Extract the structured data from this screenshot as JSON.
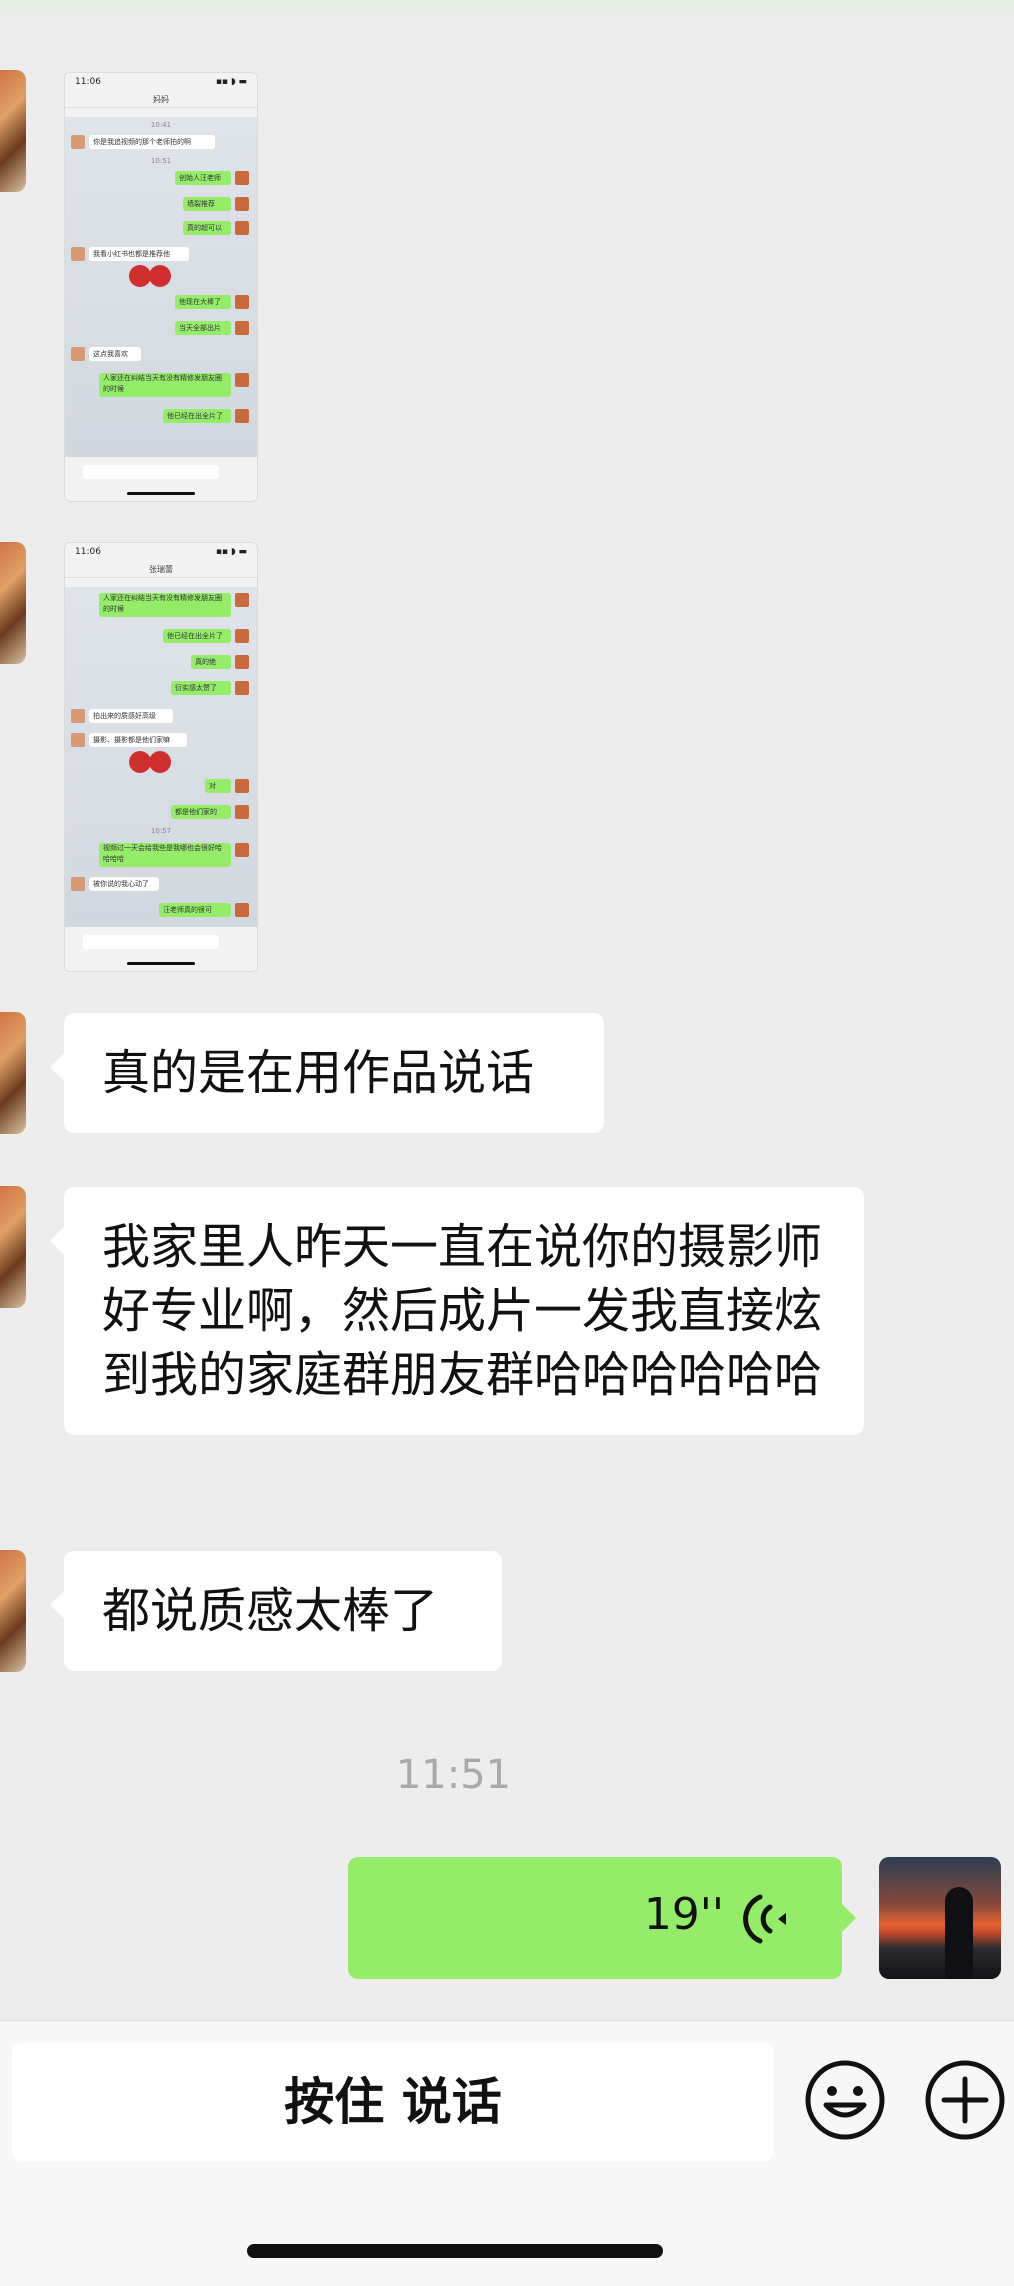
{
  "screenshot_1": {
    "status_time": "11:06",
    "nav_title": "妈妈",
    "time_a": "10:41",
    "time_b": "10:51",
    "msgs": [
      "你是我追视频的那个老师拍的啊",
      "创始人汪老师",
      "墙裂推荐",
      "真的超可以",
      "我看小红书也都是推荐他",
      "他现在大棒了",
      "当天全部出片",
      "这点我喜欢",
      "人家还在纠结当天有没有精修发朋友圈的时候",
      "他已经在出全片了"
    ]
  },
  "screenshot_2": {
    "status_time": "11:06",
    "nav_title": "张瑞蕾",
    "time_c": "10:57",
    "msgs": [
      "人家还在纠结当天有没有精修发朋友圈的时候",
      "他已经在出全片了",
      "真的绝",
      "衍实感太赞了",
      "拍出来的质感好高级",
      "摄影、摄影都是他们家嘛",
      "对",
      "都是他们家的",
      "视频过一天会给我些是我哪也会很好哈哈哈哈",
      "被你说的我心动了",
      "汪老师真的很可"
    ]
  },
  "messages": {
    "msg1": "真的是在用作品说话",
    "msg2": "我家里人昨天一直在说你的摄影师好专业啊，然后成片一发我直接炫到我的家庭群朋友群哈哈哈哈哈哈",
    "msg3": "都说质感太棒了"
  },
  "timestamp": "11:51",
  "voice_message": {
    "duration": "19''"
  },
  "input_bar": {
    "hold_to_talk": "按住 说话"
  },
  "colors": {
    "bubble_green": "#95ec69",
    "background": "#ededed",
    "bubble_white": "#ffffff"
  },
  "icons": [
    "emoji-icon",
    "plus-icon",
    "voice-wave-icon"
  ]
}
